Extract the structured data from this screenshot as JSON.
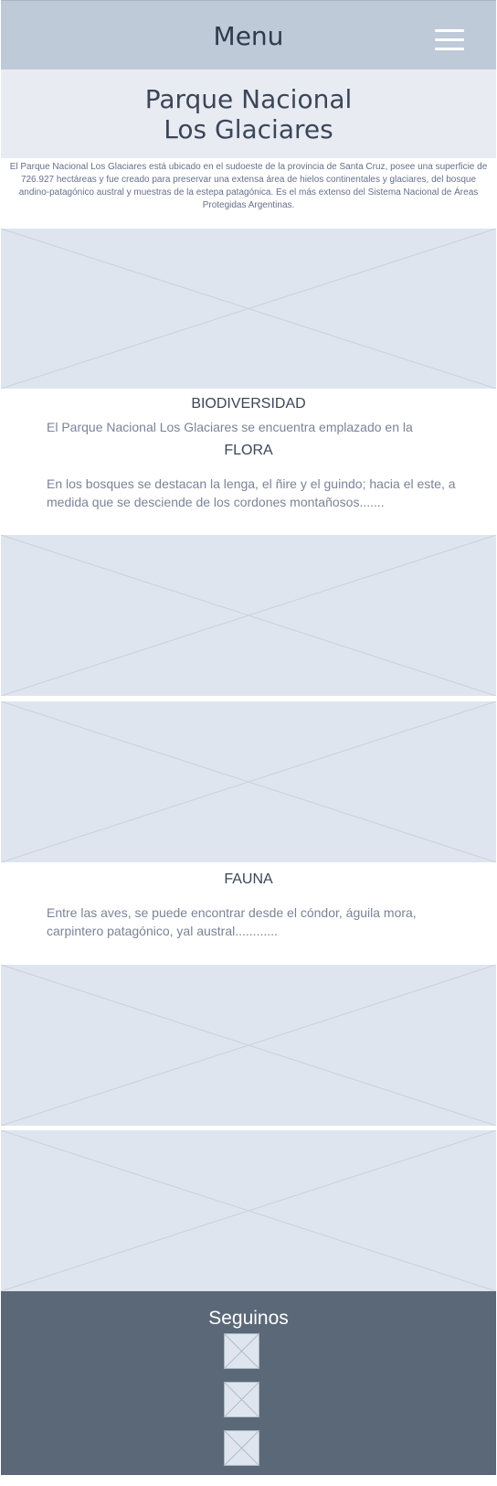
{
  "header": {
    "title": "Menu",
    "menu_icon": "hamburger-menu-icon"
  },
  "page": {
    "title_line1": "Parque Nacional",
    "title_line2": "Los Glaciares",
    "intro": "El Parque Nacional Los Glaciares está ubicado en el sudoeste de la provincia de Santa Cruz, posee una superficie de 726.927 hectáreas y fue creado para preservar una extensa área de hielos continentales y glaciares, del bosque andino-patagónico austral y muestras de la estepa patagónica. Es el más extenso del Sistema Nacional de Áreas Protegidas Argentinas."
  },
  "biodiversidad": {
    "heading": "BIODIVERSIDAD",
    "text": "El Parque Nacional Los Glaciares se encuentra emplazado en la"
  },
  "flora": {
    "heading": "FLORA",
    "text": "En los bosques se destacan la lenga, el ñire y el guindo; hacia el este, a medida que se desciende de los cordones montañosos......."
  },
  "fauna": {
    "heading": "FAUNA",
    "text": "Entre las aves, se puede encontrar desde el cóndor, águila mora, carpintero patagónico, yal austral............"
  },
  "footer": {
    "title": "Seguinos",
    "social_icons": [
      "social-icon-1",
      "social-icon-2",
      "social-icon-3"
    ]
  },
  "colors": {
    "header_bg": "#bfcad8",
    "title_bg": "#e8ecf2",
    "placeholder_bg": "#dfe5ee",
    "footer_bg": "#5b6878"
  }
}
